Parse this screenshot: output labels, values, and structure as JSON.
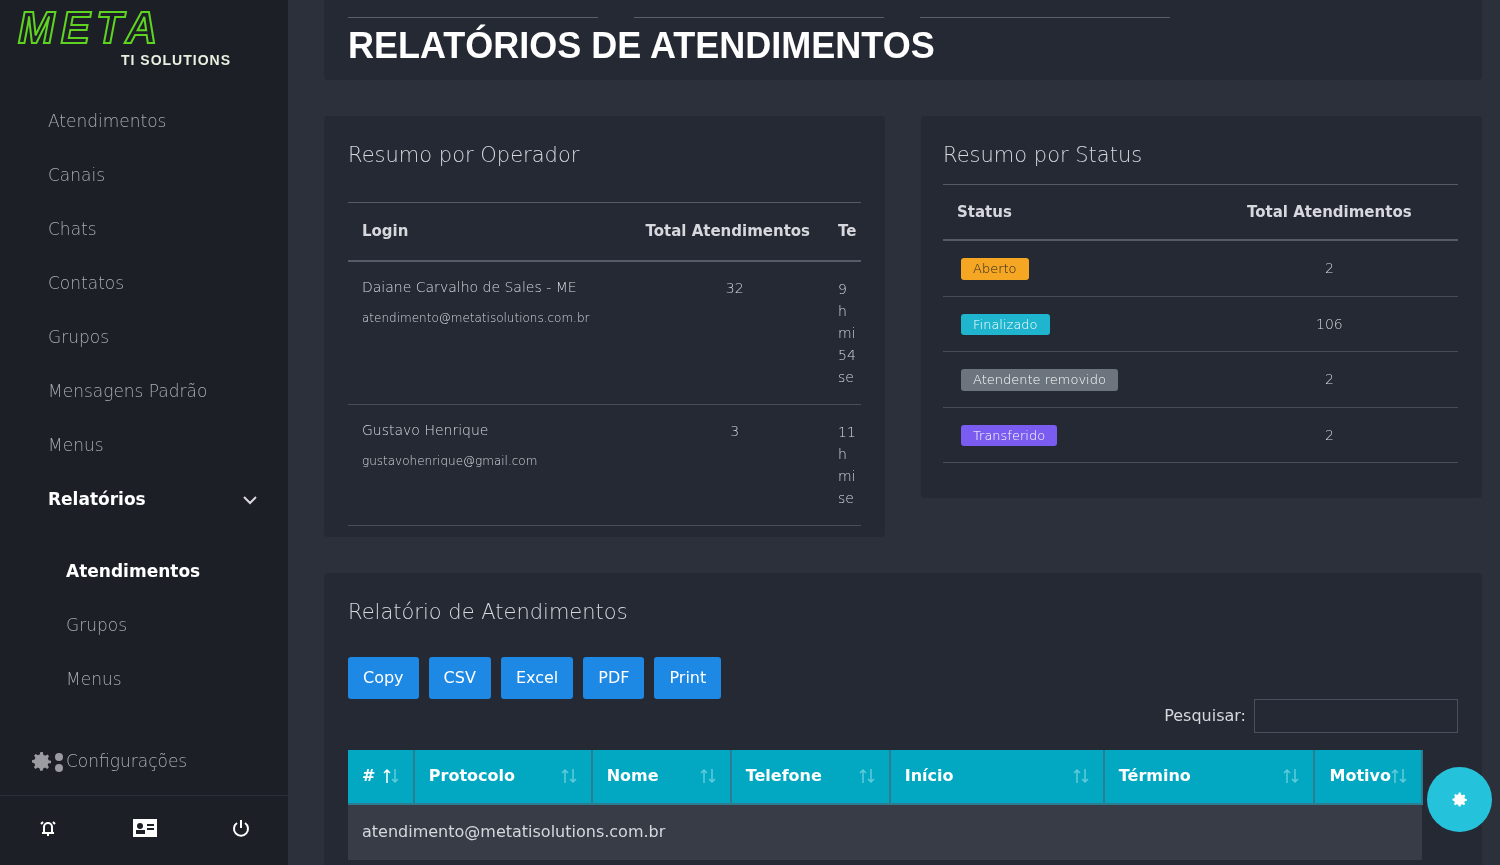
{
  "logo": {
    "wordmark": "META",
    "tagline": "TI SOLUTIONS"
  },
  "sidebar": {
    "items": [
      {
        "label": "Atendimentos",
        "kind": "link",
        "selected": false
      },
      {
        "label": "Canais",
        "kind": "link",
        "selected": false
      },
      {
        "label": "Chats",
        "kind": "link",
        "selected": false
      },
      {
        "label": "Contatos",
        "kind": "link",
        "selected": false
      },
      {
        "label": "Grupos",
        "kind": "link",
        "selected": false
      },
      {
        "label": "Mensagens Padrão",
        "kind": "link",
        "selected": false
      },
      {
        "label": "Menus",
        "kind": "link",
        "selected": false
      },
      {
        "label": "Relatórios",
        "kind": "group",
        "expanded": true,
        "selected": false,
        "children": [
          {
            "label": "Atendimentos",
            "selected": true
          },
          {
            "label": "Grupos",
            "selected": false
          },
          {
            "label": "Menus",
            "selected": false
          }
        ]
      },
      {
        "label": "Configurações",
        "kind": "settings",
        "selected": false
      }
    ]
  },
  "page_title": "RELATÓRIOS DE ATENDIMENTOS",
  "operator_summary": {
    "title": "Resumo por Operador",
    "columns": [
      "Login",
      "Total Atendimentos",
      "Te"
    ],
    "rows": [
      {
        "name": "Daiane Carvalho de Sales - ME",
        "email": "atendimento@metatisolutions.com.br",
        "total": "32",
        "time": "9 h mi 54 se"
      },
      {
        "name": "Gustavo Henrique",
        "email": "gustavohenrique@gmail.com",
        "total": "3",
        "time": "11 h mi se"
      }
    ]
  },
  "status_summary": {
    "title": "Resumo por Status",
    "columns": [
      "Status",
      "Total Atendimentos"
    ],
    "rows": [
      {
        "status": "Aberto",
        "color": "#f5a623",
        "total": "2"
      },
      {
        "status": "Finalizado",
        "color": "#1fb5cf",
        "total": "106"
      },
      {
        "status": "Atendente removido",
        "color": "#6c757d",
        "total": "2"
      },
      {
        "status": "Transferido",
        "color": "#7b5cf0",
        "total": "2"
      }
    ]
  },
  "report": {
    "title": "Relatório de Atendimentos",
    "buttons": [
      "Copy",
      "CSV",
      "Excel",
      "PDF",
      "Print"
    ],
    "search_label": "Pesquisar:",
    "columns": [
      {
        "label": "#",
        "selected": true
      },
      {
        "label": "Protocolo",
        "selected": false
      },
      {
        "label": "Nome",
        "selected": false
      },
      {
        "label": "Telefone",
        "selected": false
      },
      {
        "label": "Início",
        "selected": false
      },
      {
        "label": "Término",
        "selected": false
      },
      {
        "label": "Motivo",
        "selected": false
      }
    ],
    "group_row": "atendimento@metatisolutions.com.br"
  }
}
